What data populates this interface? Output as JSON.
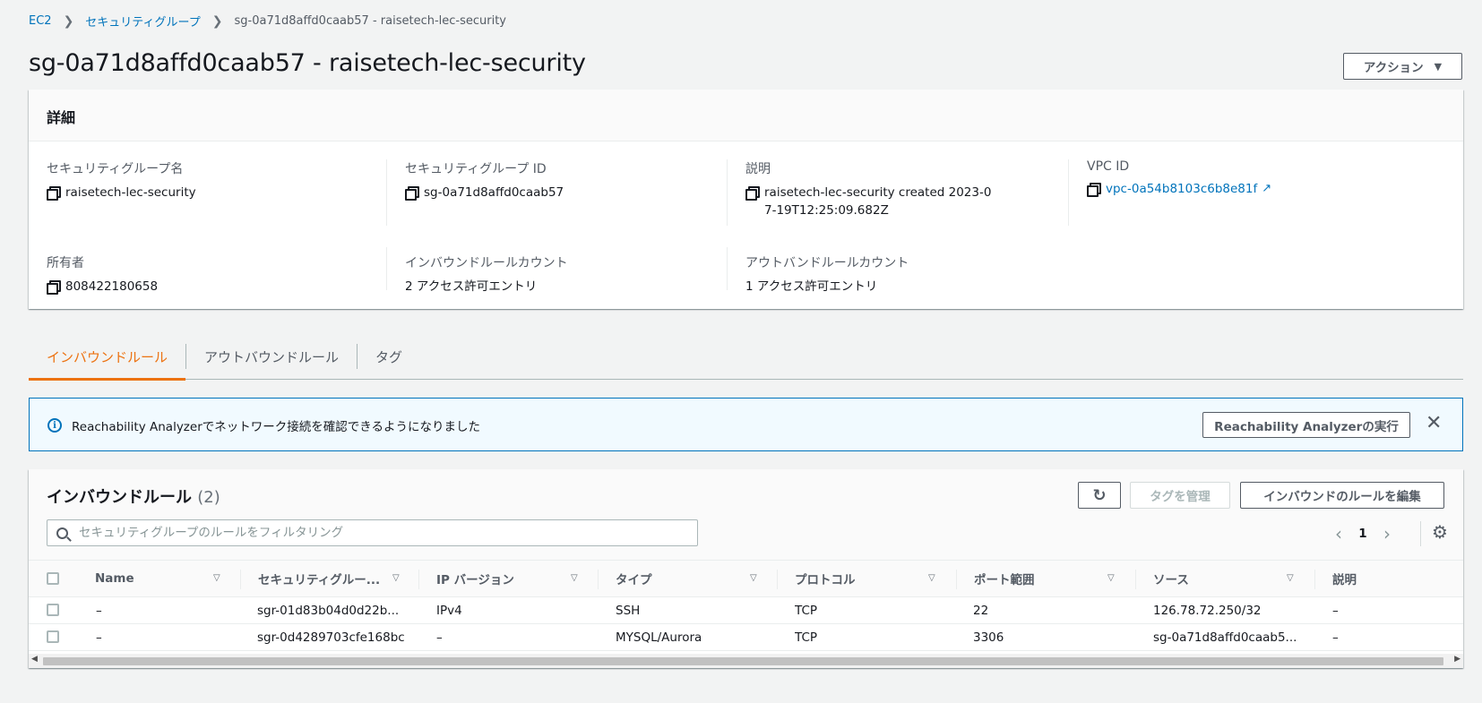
{
  "breadcrumb": {
    "items": [
      "EC2",
      "セキュリティグループ"
    ],
    "current": "sg-0a71d8affd0caab57 - raisetech-lec-security",
    "separator": "❯"
  },
  "page": {
    "title": "sg-0a71d8affd0caab57 - raisetech-lec-security",
    "action_label": "アクション",
    "action_caret": "▼"
  },
  "details": {
    "header": "詳細",
    "sg_name": {
      "label": "セキュリティグループ名",
      "value": "raisetech-lec-security"
    },
    "sg_id": {
      "label": "セキュリティグループ ID",
      "value": "sg-0a71d8affd0caab57"
    },
    "description": {
      "label": "説明",
      "value": "raisetech-lec-security created 2023-07-19T12:25:09.682Z"
    },
    "vpc_id": {
      "label": "VPC ID",
      "value": "vpc-0a54b8103c6b8e81f"
    },
    "owner": {
      "label": "所有者",
      "value": "808422180658"
    },
    "inbound_count": {
      "label": "インバウンドルールカウント",
      "value": "2 アクセス許可エントリ"
    },
    "outbound_count": {
      "label": "アウトバンドルールカウント",
      "value": "1 アクセス許可エントリ"
    }
  },
  "tabs": [
    {
      "label": "インバウンドルール",
      "active": true
    },
    {
      "label": "アウトバウンドルール",
      "active": false
    },
    {
      "label": "タグ",
      "active": false
    }
  ],
  "banner": {
    "text": "Reachability Analyzerでネットワーク接続を確認できるようになりました",
    "button_label": "Reachability Analyzerの実行",
    "close": "✕"
  },
  "rules": {
    "title": "インバウンドルール",
    "count": "(2)",
    "refresh": "↻",
    "manage_tags_label": "タグを管理",
    "edit_label": "インバウンドのルールを編集",
    "filter_placeholder": "セキュリティグループのルールをフィルタリング",
    "page": "1",
    "prev": "‹",
    "next": "›",
    "gear": "⚙",
    "columns": [
      "Name",
      "セキュリティグルー...",
      "IP バージョン",
      "タイプ",
      "プロトコル",
      "ポート範囲",
      "ソース",
      "説明"
    ],
    "sort_icon": "▽",
    "rows": [
      [
        "–",
        "sgr-01d83b04d0d22b...",
        "IPv4",
        "SSH",
        "TCP",
        "22",
        "126.78.72.250/32",
        "–"
      ],
      [
        "–",
        "sgr-0d4289703cfe168bc",
        "–",
        "MYSQL/Aurora",
        "TCP",
        "3306",
        "sg-0a71d8affd0caab5...",
        "–"
      ]
    ],
    "scroll_left": "◀",
    "scroll_right": "▶"
  },
  "colors": {
    "accent": "#ec7211",
    "link": "#0073bb",
    "banner_bg": "#f1faff"
  }
}
